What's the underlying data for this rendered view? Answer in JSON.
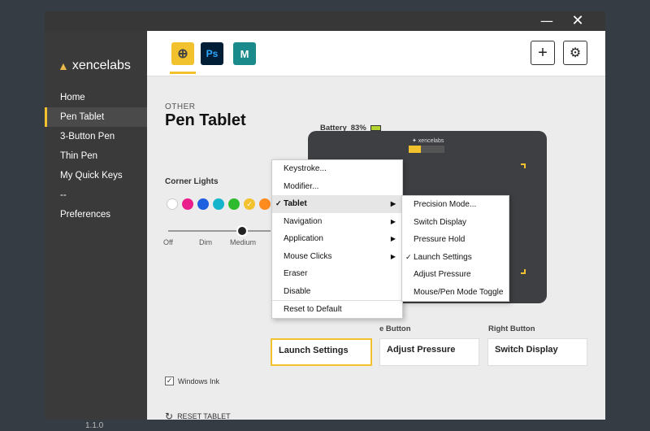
{
  "window": {
    "minimize_icon": "minimize-icon",
    "close_icon": "close-icon",
    "minimize_glyph": "—",
    "close_glyph": "✕"
  },
  "brand": {
    "name": "xencelabs",
    "logo_icon": "flame-icon",
    "accent": "#f2c12e"
  },
  "sidebar": {
    "items": [
      {
        "label": "Home"
      },
      {
        "label": "Pen Tablet"
      },
      {
        "label": "3-Button Pen"
      },
      {
        "label": "Thin Pen"
      },
      {
        "label": "My Quick Keys"
      },
      {
        "label": "--"
      },
      {
        "label": "Preferences"
      }
    ],
    "active": "Pen Tablet",
    "version": "1.1.0"
  },
  "app_tabs": [
    {
      "name": "global",
      "icon": "globe-icon",
      "glyph": "⊕"
    },
    {
      "name": "photoshop",
      "glyph": "Ps"
    },
    {
      "name": "maya",
      "glyph": "M"
    }
  ],
  "toolbar": {
    "add_glyph": "+",
    "settings_glyph": "⚙"
  },
  "page": {
    "category": "OTHER",
    "title": "Pen Tablet"
  },
  "battery": {
    "label": "Battery",
    "value": "83%"
  },
  "tablet": {
    "logo": "✦ xencelabs"
  },
  "corner_lights": {
    "label": "Corner Lights",
    "colors": [
      "#ffffff",
      "#e91e8c",
      "#1e60e0",
      "#14b4cc",
      "#2ebc2e",
      "#f2c12e",
      "#ff8a1e"
    ],
    "selected_index": 5,
    "selected_glyph": "✓",
    "brightness": {
      "levels": [
        "Off",
        "Dim",
        "Medium"
      ],
      "value": "Medium"
    }
  },
  "buttons": {
    "columns": [
      {
        "label": "",
        "value": "Launch Settings"
      },
      {
        "label": "e Button",
        "value": "Adjust Pressure"
      },
      {
        "label": "Right Button",
        "value": "Switch Display"
      }
    ]
  },
  "options": {
    "windows_ink": {
      "label": "Windows Ink",
      "checked": true,
      "glyph": "✓"
    },
    "reset": {
      "label": "RESET TABLET",
      "glyph": "↻"
    }
  },
  "context_menu": {
    "items": [
      {
        "label": "Keystroke..."
      },
      {
        "label": "Modifier..."
      },
      {
        "label": "Tablet",
        "checked": true,
        "submenu": true,
        "highlighted": true
      },
      {
        "label": "Navigation",
        "submenu": true
      },
      {
        "label": "Application",
        "submenu": true
      },
      {
        "label": "Mouse Clicks",
        "submenu": true
      },
      {
        "label": "Eraser"
      },
      {
        "label": "Disable"
      },
      {
        "label": "Reset to Default",
        "separator": true
      }
    ],
    "check_glyph": "✓",
    "arrow_glyph": "▶"
  },
  "submenu": {
    "items": [
      {
        "label": "Precision Mode..."
      },
      {
        "label": "Switch Display"
      },
      {
        "label": "Pressure Hold"
      },
      {
        "label": "Launch Settings",
        "checked": true
      },
      {
        "label": "Adjust Pressure"
      },
      {
        "label": "Mouse/Pen Mode Toggle"
      }
    ]
  }
}
